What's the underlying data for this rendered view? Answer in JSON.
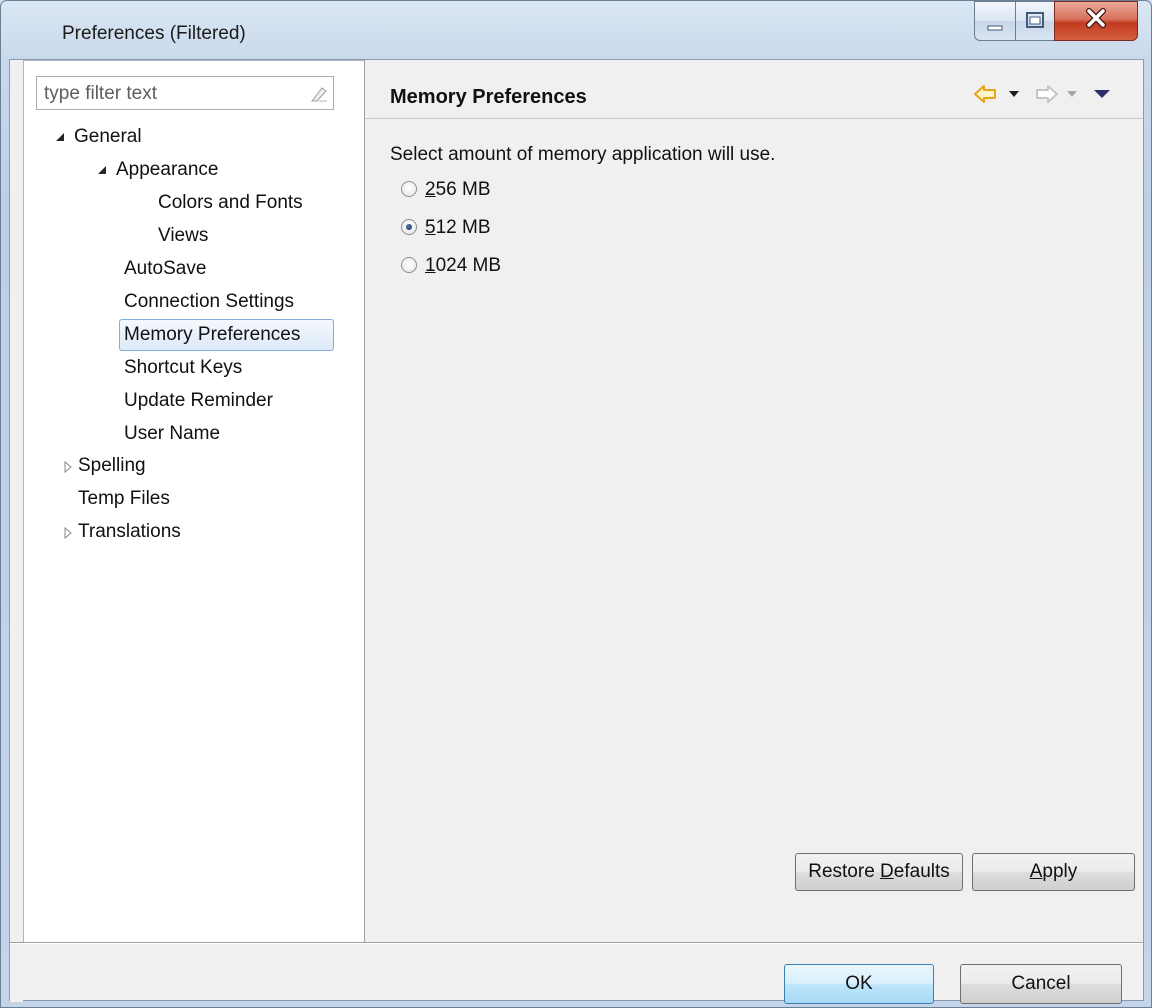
{
  "window": {
    "title": "Preferences (Filtered)"
  },
  "filter": {
    "placeholder": "type filter text"
  },
  "tree": {
    "items": [
      {
        "label": "General",
        "twisty": "expanded"
      },
      {
        "label": "Appearance",
        "twisty": "expanded"
      },
      {
        "label": "Colors and Fonts",
        "twisty": "none"
      },
      {
        "label": "Views",
        "twisty": "none"
      },
      {
        "label": "AutoSave",
        "twisty": "none"
      },
      {
        "label": "Connection Settings",
        "twisty": "none"
      },
      {
        "label": "Memory Preferences",
        "twisty": "none",
        "selected": true
      },
      {
        "label": "Shortcut Keys",
        "twisty": "none"
      },
      {
        "label": "Update Reminder",
        "twisty": "none"
      },
      {
        "label": "User Name",
        "twisty": "none"
      },
      {
        "label": "Spelling",
        "twisty": "collapsed"
      },
      {
        "label": "Temp Files",
        "twisty": "none"
      },
      {
        "label": "Translations",
        "twisty": "collapsed"
      }
    ]
  },
  "page": {
    "title": "Memory Preferences",
    "description": "Select amount of memory application will use.",
    "options": [
      {
        "mnemonic": "2",
        "rest": "56 MB",
        "checked": false
      },
      {
        "mnemonic": "5",
        "rest": "12 MB",
        "checked": true
      },
      {
        "mnemonic": "1",
        "rest": "024 MB",
        "checked": false
      }
    ],
    "restore_defaults": {
      "before": "Restore ",
      "mnemonic": "D",
      "after": "efaults"
    },
    "apply": {
      "before": "",
      "mnemonic": "A",
      "after": "pply"
    }
  },
  "footer": {
    "ok_label": "OK",
    "cancel_label": "Cancel"
  },
  "colors": {
    "selection_border": "#84acdd",
    "nav_back_arrow": "#e8a317",
    "default_button_border": "#3c7fb1"
  },
  "icons": {
    "back": "back-arrow-icon",
    "forward": "forward-arrow-icon",
    "menu": "view-menu-icon"
  }
}
